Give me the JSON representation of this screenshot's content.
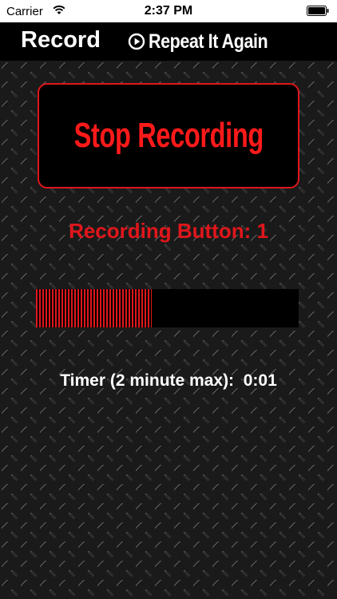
{
  "status_bar": {
    "carrier": "Carrier",
    "time": "2:37 PM",
    "wifi_icon": "wifi-icon",
    "battery_icon": "battery-icon"
  },
  "nav": {
    "title": "Record",
    "brand_text": "Repeat It Again",
    "brand_icon": "play-circle-icon"
  },
  "stop_button": {
    "label": "Stop Recording"
  },
  "recording_label": "Recording Button: 1",
  "progress": {
    "value": 0.44
  },
  "timer": {
    "label": "Timer (2 minute max):",
    "value": "0:01"
  },
  "colors": {
    "accent_red": "#e0161b",
    "nav_background": "#000000",
    "status_background": "#ffffff",
    "text_white": "#ffffff"
  }
}
